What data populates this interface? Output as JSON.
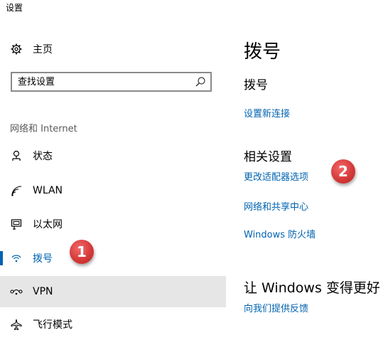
{
  "window": {
    "title": "设置"
  },
  "nav": {
    "home_label": "主页",
    "search_placeholder": "查找设置",
    "section_header": "网络和 Internet",
    "items": [
      {
        "label": "状态",
        "icon": "status-icon"
      },
      {
        "label": "WLAN",
        "icon": "wifi-icon"
      },
      {
        "label": "以太网",
        "icon": "ethernet-icon"
      },
      {
        "label": "拨号",
        "icon": "dialup-icon",
        "active": true
      },
      {
        "label": "VPN",
        "icon": "vpn-icon"
      },
      {
        "label": "飞行模式",
        "icon": "airplane-icon"
      }
    ]
  },
  "main": {
    "title": "拨号",
    "dialup_heading": "拨号",
    "new_connection_link": "设置新连接",
    "related_heading": "相关设置",
    "related_links": [
      "更改适配器选项",
      "网络和共享中心",
      "Windows 防火墙"
    ],
    "improve_heading": "让 Windows 变得更好",
    "feedback_link": "向我们提供反馈"
  },
  "callouts": [
    "1",
    "2"
  ],
  "colors": {
    "accent": "#0063b1",
    "badge": "#d63a3a",
    "hover": "#e6e6e6"
  }
}
